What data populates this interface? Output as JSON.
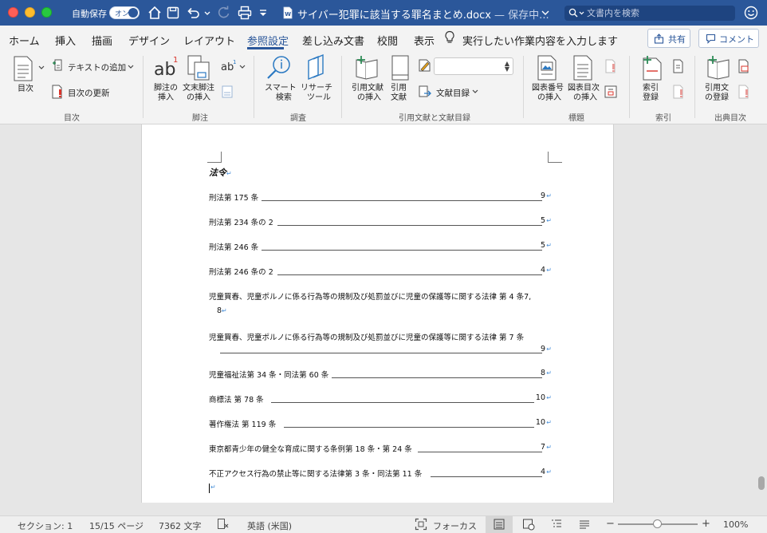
{
  "titlebar": {
    "autosave_label": "自動保存",
    "autosave_state": "オン",
    "doc_title": "サイバー犯罪に該当する罪名まとめ.docx",
    "save_status": " — 保存中...",
    "search_placeholder": "文書内を検索"
  },
  "tabs": [
    "ホーム",
    "挿入",
    "描画",
    "デザイン",
    "レイアウト",
    "参照設定",
    "差し込み文書",
    "校閲",
    "表示"
  ],
  "active_tab": "参照設定",
  "tell_me": "実行したい作業内容を入力します",
  "share_label": "共有",
  "comment_label": "コメント",
  "ribbon": {
    "toc_label": "目次",
    "add_text": "テキストの追加",
    "update_toc": "目次の更新",
    "footnote_1": "脚注の",
    "footnote_2": "挿入",
    "endnote_1": "文末脚注",
    "endnote_2": "の挿入",
    "smart_1": "スマート",
    "smart_2": "検索",
    "research_1": "リサーチ",
    "research_2": "ツール",
    "cite_insert_1": "引用文献",
    "cite_insert_2": "の挿入",
    "cite_1": "引用",
    "cite_2": "文献",
    "bibliography": "文献目録",
    "caption_1": "図表番号",
    "caption_2": "の挿入",
    "tof_1": "図表目次",
    "tof_2": "の挿入",
    "index_1": "索引",
    "index_2": "登録",
    "citation_mark_1": "引用文",
    "citation_mark_2": "の登録",
    "groups": {
      "toc": "目次",
      "footnotes": "脚注",
      "research": "調査",
      "citations": "引用文献と文献目録",
      "captions": "標題",
      "index": "索引",
      "toa": "出典目次"
    }
  },
  "document": {
    "heading": "法令",
    "entries": [
      {
        "text": "刑法第 175 条",
        "page": "9"
      },
      {
        "text": "刑法第 234 条の 2",
        "page": "5"
      },
      {
        "text": "刑法第 246 条",
        "page": "5"
      },
      {
        "text": "刑法第 246 条の 2",
        "page": "4"
      },
      {
        "text": "児童買春、児童ポルノに係る行為等の規制及び処罰並びに児童の保護等に関する法律  第 4 条7,",
        "page": "8"
      },
      {
        "text": "児童買春、児童ポルノに係る行為等の規制及び処罰並びに児童の保護等に関する法律   第 7 条",
        "page": "9"
      },
      {
        "text": "児童福祉法第 34 条・同法第 60 条",
        "page": "8"
      },
      {
        "text": "商標法   第 78 条",
        "page": "10"
      },
      {
        "text": "著作権法   第 119 条",
        "page": "10"
      },
      {
        "text": "東京都青少年の健全な育成に関する条例第 18 条・第 24 条",
        "page": "7"
      },
      {
        "text": "不正アクセス行為の禁止等に関する法律第 3 条・同法第 11 条",
        "page": "4"
      }
    ]
  },
  "status": {
    "section": "セクション: 1",
    "pages": "15/15 ページ",
    "words": "7362 文字",
    "language": "英語 (米国)",
    "focus": "フォーカス",
    "zoom": "100%"
  },
  "colors": {
    "accent": "#2b579a",
    "paragraph_mark": "#4a90d9",
    "close": "#fe5f57",
    "minimize": "#febc2e",
    "maximize": "#28c840"
  }
}
